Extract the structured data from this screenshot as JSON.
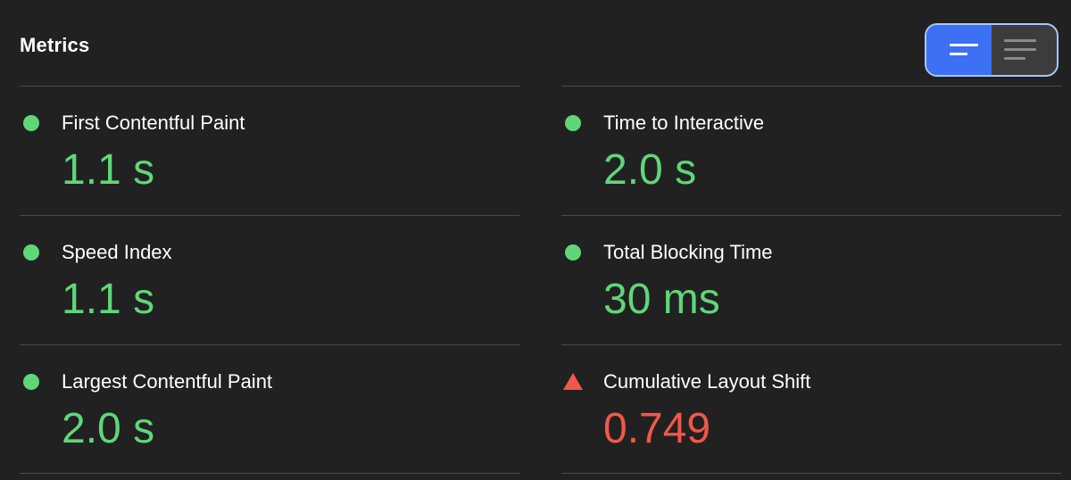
{
  "header": {
    "title": "Metrics",
    "view_toggle": {
      "active": "expanded-view",
      "options": [
        "expanded-view",
        "collapsed-view"
      ]
    }
  },
  "colors": {
    "pass": "#5fd779",
    "fail": "#f1574a",
    "toggle_active": "#3d71f5",
    "background": "#212121"
  },
  "metrics": {
    "left": [
      {
        "label": "First Contentful Paint",
        "value": "1.1 s",
        "status": "pass"
      },
      {
        "label": "Speed Index",
        "value": "1.1 s",
        "status": "pass"
      },
      {
        "label": "Largest Contentful Paint",
        "value": "2.0 s",
        "status": "pass"
      }
    ],
    "right": [
      {
        "label": "Time to Interactive",
        "value": "2.0 s",
        "status": "pass"
      },
      {
        "label": "Total Blocking Time",
        "value": "30 ms",
        "status": "pass"
      },
      {
        "label": "Cumulative Layout Shift",
        "value": "0.749",
        "status": "fail"
      }
    ]
  }
}
